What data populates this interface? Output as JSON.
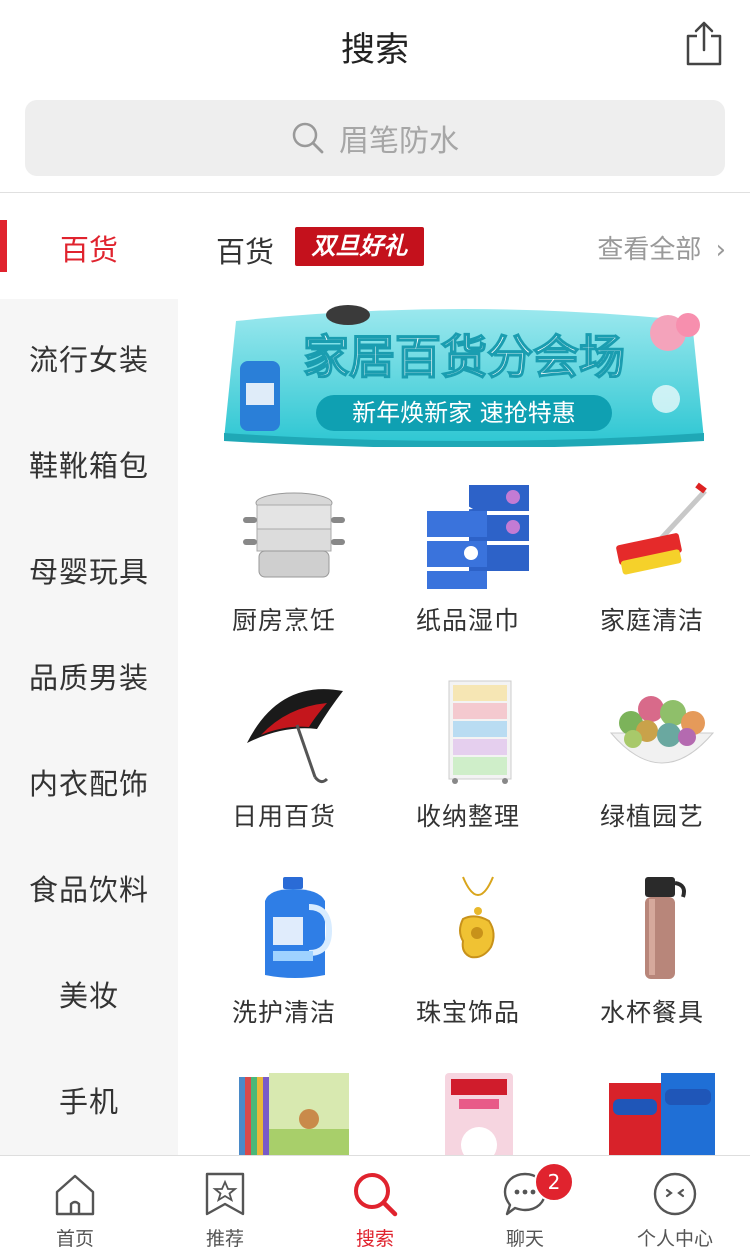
{
  "header": {
    "title": "搜索",
    "share_icon": "share-icon"
  },
  "search": {
    "placeholder": "眉笔防水",
    "icon": "search-icon"
  },
  "sidebar": {
    "active": "百货",
    "items": [
      "流行女装",
      "鞋靴箱包",
      "母婴玩具",
      "品质男装",
      "内衣配饰",
      "食品饮料",
      "美妆",
      "手机"
    ]
  },
  "section": {
    "title": "百货",
    "badge": "双旦好礼",
    "view_all": "查看全部",
    "banner": {
      "title": "家居百货分会场",
      "subtitle": "新年焕新家 速抢特惠"
    }
  },
  "grid": [
    {
      "label": "厨房烹饪",
      "icon": "steamer-pot-icon"
    },
    {
      "label": "纸品湿巾",
      "icon": "tissue-box-icon"
    },
    {
      "label": "家庭清洁",
      "icon": "mop-icon"
    },
    {
      "label": "日用百货",
      "icon": "umbrella-icon"
    },
    {
      "label": "收纳整理",
      "icon": "drawer-cabinet-icon"
    },
    {
      "label": "绿植园艺",
      "icon": "succulent-plant-icon"
    },
    {
      "label": "洗护清洁",
      "icon": "detergent-bottle-icon"
    },
    {
      "label": "珠宝饰品",
      "icon": "gold-pendant-icon"
    },
    {
      "label": "水杯餐具",
      "icon": "thermos-icon"
    },
    {
      "label": "",
      "icon": "book-set-icon"
    },
    {
      "label": "",
      "icon": "pet-food-icon"
    },
    {
      "label": "",
      "icon": "condom-box-icon"
    }
  ],
  "tabbar": [
    {
      "label": "首页",
      "icon": "home-icon"
    },
    {
      "label": "推荐",
      "icon": "bookmark-star-icon"
    },
    {
      "label": "搜索",
      "icon": "search-icon",
      "active": true
    },
    {
      "label": "聊天",
      "icon": "chat-bubble-icon",
      "badge": "2"
    },
    {
      "label": "个人中心",
      "icon": "profile-face-icon"
    }
  ],
  "colors": {
    "accent": "#e0232e",
    "badge_bg": "#c4111c",
    "sidebar_bg": "#f6f6f6"
  }
}
